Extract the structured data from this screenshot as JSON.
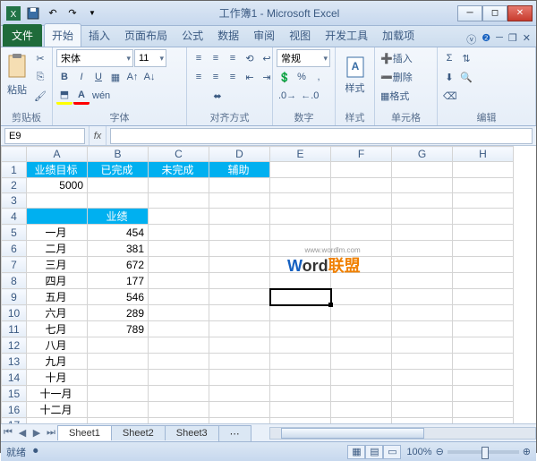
{
  "title": "工作簿1 - Microsoft Excel",
  "qat": {
    "save": "💾",
    "undo": "↶",
    "redo": "↷"
  },
  "tabs": {
    "file": "文件",
    "items": [
      "开始",
      "插入",
      "页面布局",
      "公式",
      "数据",
      "审阅",
      "视图",
      "开发工具",
      "加载项"
    ],
    "active": 0
  },
  "ribbon": {
    "clipboard": {
      "label": "剪贴板",
      "paste": "粘贴"
    },
    "font": {
      "label": "字体",
      "name": "宋体",
      "size": "11"
    },
    "align": {
      "label": "对齐方式",
      "wrap": "常规"
    },
    "number": {
      "label": "数字",
      "format": "常规"
    },
    "styles": {
      "label": "样式",
      "btn": "样式"
    },
    "cells": {
      "label": "单元格",
      "insert": "插入",
      "delete": "删除",
      "format": "格式"
    },
    "editing": {
      "label": "编辑"
    }
  },
  "namebox": "E9",
  "columns": [
    "A",
    "B",
    "C",
    "D",
    "E",
    "F",
    "G",
    "H"
  ],
  "header_row": [
    "业绩目标",
    "已完成",
    "未完成",
    "辅助"
  ],
  "row2_a": "5000",
  "row4_b": "业绩",
  "months": [
    "一月",
    "二月",
    "三月",
    "四月",
    "五月",
    "六月",
    "七月",
    "八月",
    "九月",
    "十月",
    "十一月",
    "十二月"
  ],
  "values": [
    "454",
    "381",
    "672",
    "177",
    "546",
    "289",
    "789",
    "",
    "",
    "",
    "",
    ""
  ],
  "watermark": {
    "w": "W",
    "ord": "ord",
    "lm": "联盟",
    "url": "www.wordlm.com"
  },
  "sheets": [
    "Sheet1",
    "Sheet2",
    "Sheet3"
  ],
  "status": {
    "ready": "就绪",
    "rec": "",
    "zoom": "100%"
  }
}
